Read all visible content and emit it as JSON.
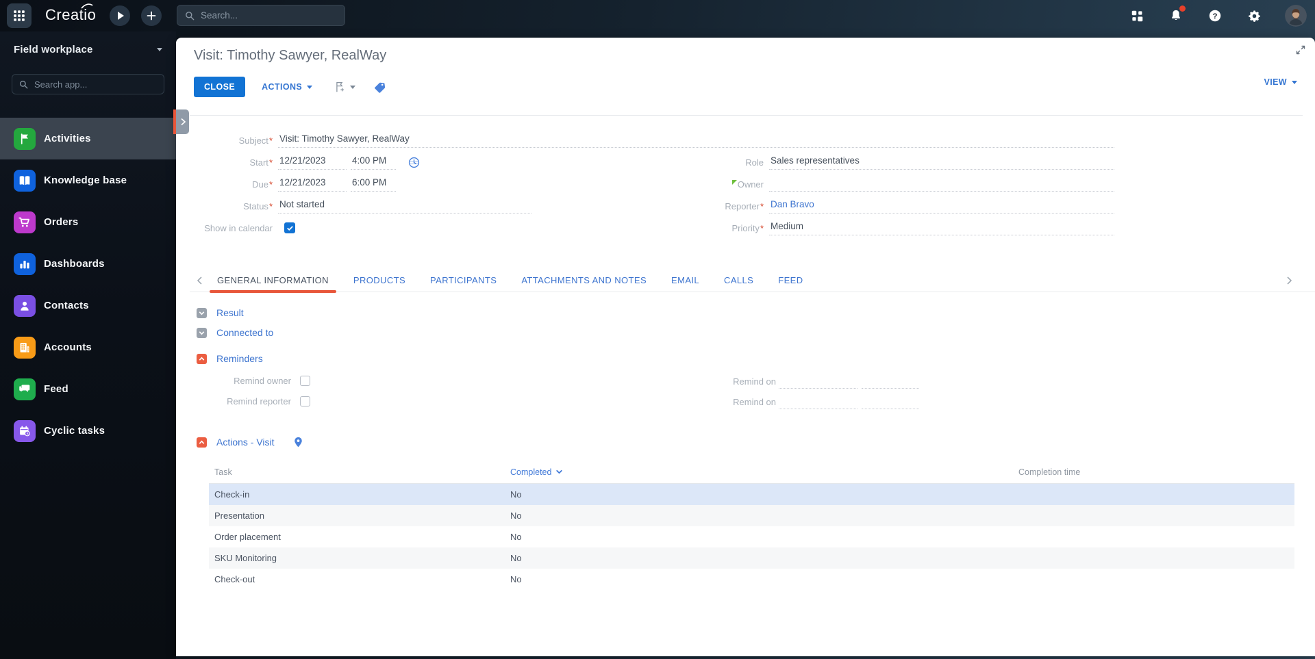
{
  "required_mark": "*",
  "topbar": {
    "logo_text": "Creatio",
    "search_placeholder": "Search...",
    "notification_dot_color": "#e8402a"
  },
  "sidebar": {
    "workplace_label": "Field workplace",
    "app_search_placeholder": "Search app...",
    "items": [
      {
        "label": "Activities",
        "icon": "flag-icon",
        "color": "#24a83e",
        "active": true
      },
      {
        "label": "Knowledge base",
        "icon": "book-icon",
        "color": "#0f62dd",
        "active": false
      },
      {
        "label": "Orders",
        "icon": "cart-icon",
        "color": "#bd39cc",
        "active": false
      },
      {
        "label": "Dashboards",
        "icon": "chart-icon",
        "color": "#0f62dd",
        "active": false
      },
      {
        "label": "Contacts",
        "icon": "person-icon",
        "color": "#7a4fe3",
        "active": false
      },
      {
        "label": "Accounts",
        "icon": "building-icon",
        "color": "#f89b17",
        "active": false
      },
      {
        "label": "Feed",
        "icon": "chat-icon",
        "color": "#1fad4d",
        "active": false
      },
      {
        "label": "Cyclic tasks",
        "icon": "calendar-clock-icon",
        "color": "#8758ea",
        "active": false
      }
    ]
  },
  "page": {
    "title": "Visit: Timothy Sawyer, RealWay",
    "close_button": "CLOSE",
    "actions_button": "ACTIONS",
    "view_button": "VIEW"
  },
  "form": {
    "subject": {
      "label": "Subject",
      "required": true,
      "value": "Visit: Timothy Sawyer, RealWay"
    },
    "start": {
      "label": "Start",
      "required": true,
      "date": "12/21/2023",
      "time": "4:00 PM"
    },
    "due": {
      "label": "Due",
      "required": true,
      "date": "12/21/2023",
      "time": "6:00 PM"
    },
    "status": {
      "label": "Status",
      "required": true,
      "value": "Not started"
    },
    "show_in_calendar": {
      "label": "Show in calendar",
      "checked": true
    },
    "role": {
      "label": "Role",
      "value": "Sales representatives"
    },
    "owner": {
      "label": "Owner",
      "value": "",
      "changed": true
    },
    "reporter": {
      "label": "Reporter",
      "required": true,
      "value": "Dan Bravo"
    },
    "priority": {
      "label": "Priority",
      "required": true,
      "value": "Medium"
    }
  },
  "tabs": [
    {
      "label": "GENERAL INFORMATION",
      "active": true
    },
    {
      "label": "PRODUCTS",
      "active": false
    },
    {
      "label": "PARTICIPANTS",
      "active": false
    },
    {
      "label": "ATTACHMENTS AND NOTES",
      "active": false
    },
    {
      "label": "EMAIL",
      "active": false
    },
    {
      "label": "CALLS",
      "active": false
    },
    {
      "label": "FEED",
      "active": false
    }
  ],
  "sections": {
    "result": "Result",
    "connected_to": "Connected to",
    "reminders": "Reminders",
    "remind_owner": "Remind owner",
    "remind_reporter": "Remind reporter",
    "remind_on_owner": "Remind on",
    "remind_on_reporter": "Remind on",
    "actions_visit": "Actions - Visit"
  },
  "actions_table": {
    "columns": {
      "task": "Task",
      "completed": "Completed",
      "completion_time": "Completion time"
    },
    "sorted_by": "Completed",
    "rows": [
      {
        "task": "Check-in",
        "completed": "No",
        "completion_time": "",
        "selected": true
      },
      {
        "task": "Presentation",
        "completed": "No",
        "completion_time": "",
        "selected": false
      },
      {
        "task": "Order placement",
        "completed": "No",
        "completion_time": "",
        "selected": false
      },
      {
        "task": "SKU Monitoring",
        "completed": "No",
        "completion_time": "",
        "selected": false
      },
      {
        "task": "Check-out",
        "completed": "No",
        "completion_time": "",
        "selected": false
      }
    ]
  },
  "colors": {
    "accent_orange": "#e8563a",
    "primary_blue": "#1273d4",
    "link_blue": "#3d74cf"
  }
}
